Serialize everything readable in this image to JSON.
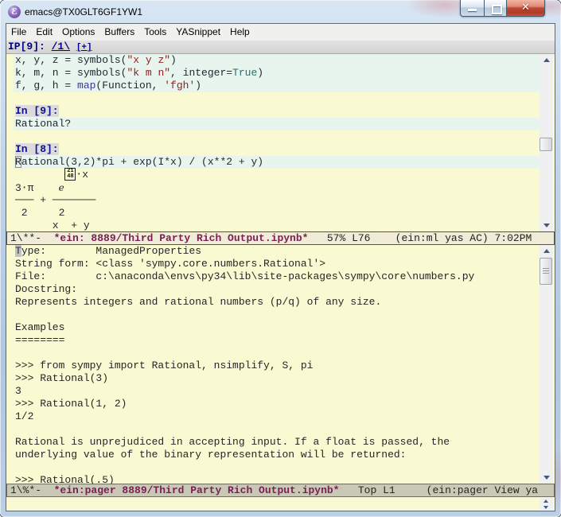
{
  "window": {
    "title": "emacs@TX0GLT6GF1YW1",
    "close_glyph": "✕"
  },
  "menu": {
    "items": [
      "File",
      "Edit",
      "Options",
      "Buffers",
      "Tools",
      "YASnippet",
      "Help"
    ]
  },
  "header_line": {
    "prefix": "IP[9]: ",
    "tab_current": "/1\\",
    "tab_new": "[+]"
  },
  "upper_buffer": {
    "code1": {
      "a": "x, y, z = symbols(",
      "s": "\"x y z\"",
      "b": ")"
    },
    "code2": {
      "a": "k, m, n = symbols(",
      "s": "\"k m n\"",
      "b": ", integer=",
      "c": "True",
      "d": ")"
    },
    "code3": {
      "a": "f, g, h = ",
      "fn": "map",
      "b": "(Function, ",
      "s": "'fgh'",
      "c": ")"
    },
    "prompt9": "In [9]:",
    "query": "Rational?",
    "prompt8": "In [8]:",
    "code4_cursor": "R",
    "code4_rest": "ational(3,2)*pi + exp(I*x) / (x**2 + y)",
    "math": {
      "sup_pre": "        ",
      "box_top": "21",
      "box_bottom": "48",
      "sup_post": "⋅x",
      "row2_a": "3⋅π    ",
      "row2_e": "e",
      "row3": "─── + ───────",
      "row4": " 2     2",
      "row5": "      x  + y"
    }
  },
  "mode_line_top": {
    "flags": "1\\**-  ",
    "buffer_name": "*ein: 8889/Third Party Rich Output.ipynb*",
    "rest": "   57% L76    (ein:ml yas AC) 7:02PM"
  },
  "lower_buffer": {
    "first_cursor": "T",
    "first_rest": "ype:        ManagedProperties",
    "lines": [
      "String form: <class 'sympy.core.numbers.Rational'>",
      "File:        c:\\anaconda\\envs\\py34\\lib\\site-packages\\sympy\\core\\numbers.py",
      "Docstring:",
      "Represents integers and rational numbers (p/q) of any size.",
      "",
      "Examples",
      "========",
      "",
      ">>> from sympy import Rational, nsimplify, S, pi",
      ">>> Rational(3)",
      "3",
      ">>> Rational(1, 2)",
      "1/2",
      "",
      "Rational is unprejudiced in accepting input. If a float is passed, the",
      "underlying value of the binary representation will be returned:",
      "",
      ">>> Rational(.5)"
    ]
  },
  "mode_line_bottom": {
    "flags": "1\\%*-  ",
    "buffer_name": "*ein:pager 8889/Third Party Rich Output.ipynb*",
    "rest": "   Top L1     (ein:pager View ya"
  }
}
